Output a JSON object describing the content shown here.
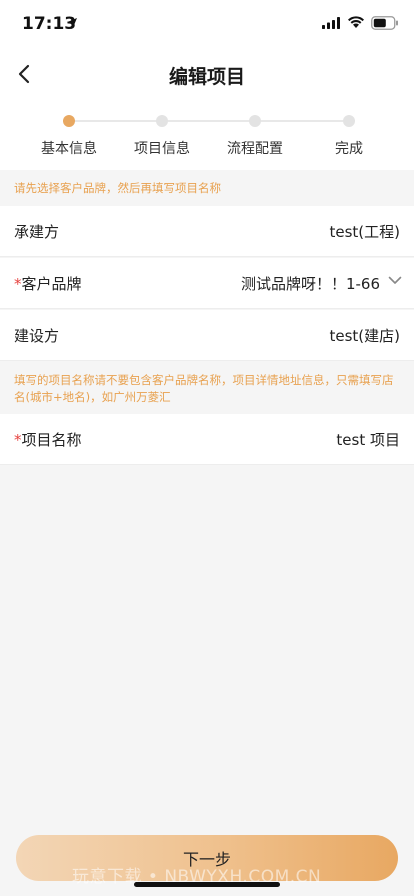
{
  "status_bar": {
    "time": "17:13"
  },
  "nav": {
    "title": "编辑项目"
  },
  "steps": [
    {
      "label": "基本信息",
      "active": true
    },
    {
      "label": "项目信息",
      "active": false
    },
    {
      "label": "流程配置",
      "active": false
    },
    {
      "label": "完成",
      "active": false
    }
  ],
  "notices": {
    "first": "请先选择客户品牌，然后再填写项目名称",
    "second": "填写的项目名称请不要包含客户品牌名称，项目详情地址信息，只需填写店名(城市+地名)，如广州万菱汇"
  },
  "rows": {
    "contractor": {
      "label": "承建方",
      "value": "test(工程)"
    },
    "brand": {
      "required_mark": "*",
      "label": "客户品牌",
      "value": "测试品牌呀！！1-66"
    },
    "builder": {
      "label": "建设方",
      "value": "test(建店)"
    },
    "project_name": {
      "required_mark": "*",
      "label": "项目名称",
      "value": "test 项目"
    }
  },
  "bottom": {
    "next_label": "下一步"
  },
  "watermark": "玩意下载 • NBWYXH.COM.CN",
  "colors": {
    "accent": "#e8a861",
    "notice_text": "#e8a14f",
    "required": "#e64340"
  }
}
